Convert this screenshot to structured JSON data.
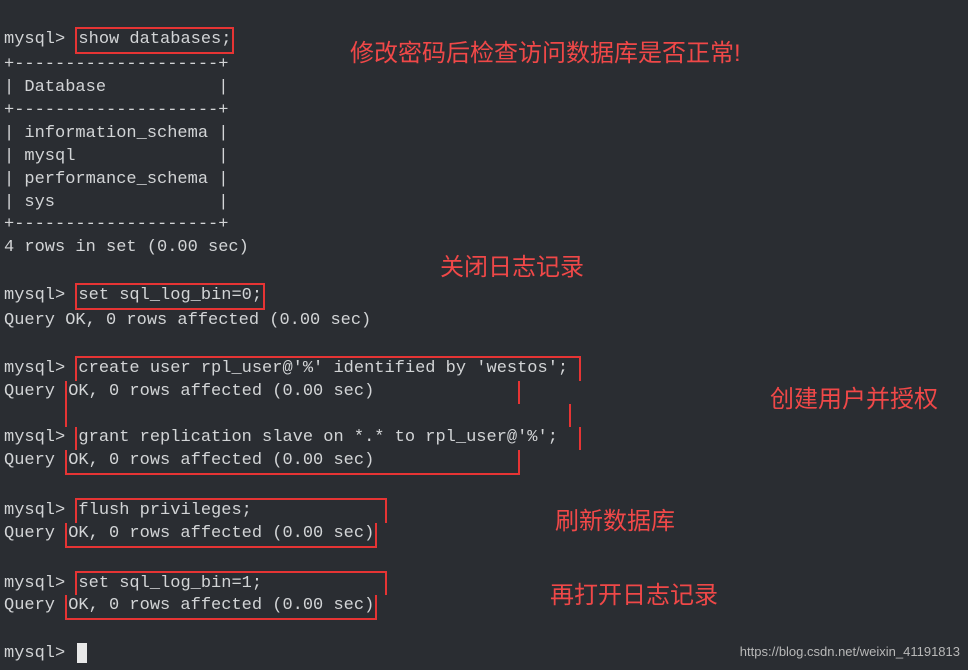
{
  "prompt": "mysql> ",
  "cmd_show": "show databases;",
  "border": "+--------------------+",
  "header": "| Database           |",
  "rows": [
    "| information_schema |",
    "| mysql              |",
    "| performance_schema |",
    "| sys                |"
  ],
  "rows_in_set": "4 rows in set (0.00 sec)",
  "blank": "",
  "cmd_setlog0": "set sql_log_bin=0;",
  "ok": "Query OK, 0 rows affected (0.00 sec)",
  "ok_left": "Query ",
  "ok_mid": "OK, 0 rows affected (0.00 sec)",
  "cmd_create_user": "create user rpl_user@'%' identified by 'westos';",
  "cmd_grant": "grant replication slave on *.* to rpl_user@'%';",
  "ok_mid_pad": "OK, 0 rows affected (0.00 sec)              ",
  "grant_pad": "grant replication slave on *.* to rpl_user@'%';  ",
  "create_pad": "create user rpl_user@'%' identified by 'westos'; ",
  "inter_blank_pad": "                                                 ",
  "cmd_flush": "flush privileges;",
  "cmd_setlog1": "set sql_log_bin=1;",
  "annotations": {
    "check_db": "修改密码后检查访问数据库是否正常!",
    "close_log": "关闭日志记录",
    "create_user": "创建用户并授权",
    "refresh_db": "刷新数据库",
    "reopen_log": "再打开日志记录"
  },
  "watermark": "https://blog.csdn.net/weixin_41191813",
  "final_prompt": "mysql> "
}
